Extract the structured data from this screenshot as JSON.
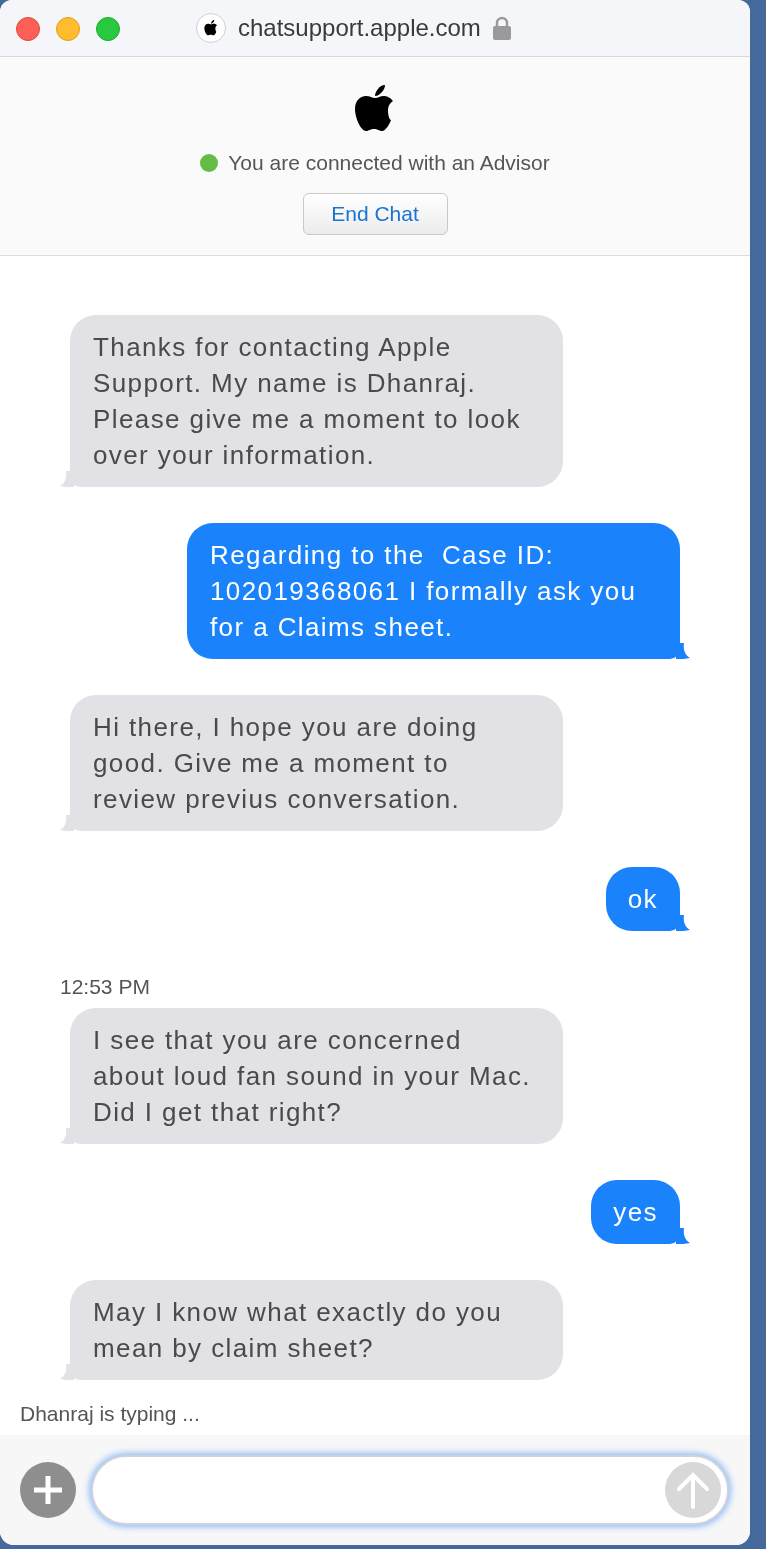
{
  "window": {
    "url": "chatsupport.apple.com",
    "secure": true
  },
  "header": {
    "connected": true,
    "status_text": "You are connected with an Advisor",
    "end_button": "End Chat"
  },
  "messages": [
    {
      "kind": "advisor",
      "text": "Thanks for contacting Apple Support. My name is Dhanraj. Please give me a moment to look over your information."
    },
    {
      "kind": "user",
      "text": "Regarding to the  Case ID: 102019368061 I formally ask you for a Claims sheet."
    },
    {
      "kind": "advisor",
      "text": "Hi there, I hope you are doing good. Give me a moment to review previus conversation."
    },
    {
      "kind": "user",
      "text": "ok"
    },
    {
      "kind": "time",
      "text": "12:53 PM"
    },
    {
      "kind": "advisor",
      "text": "I see that you are concerned about loud fan sound in your Mac. Did I get that right?"
    },
    {
      "kind": "user",
      "text": "yes"
    },
    {
      "kind": "advisor",
      "text": "May I know what exactly do you mean by claim sheet?"
    }
  ],
  "typing_indicator": "Dhanraj is typing ..."
}
